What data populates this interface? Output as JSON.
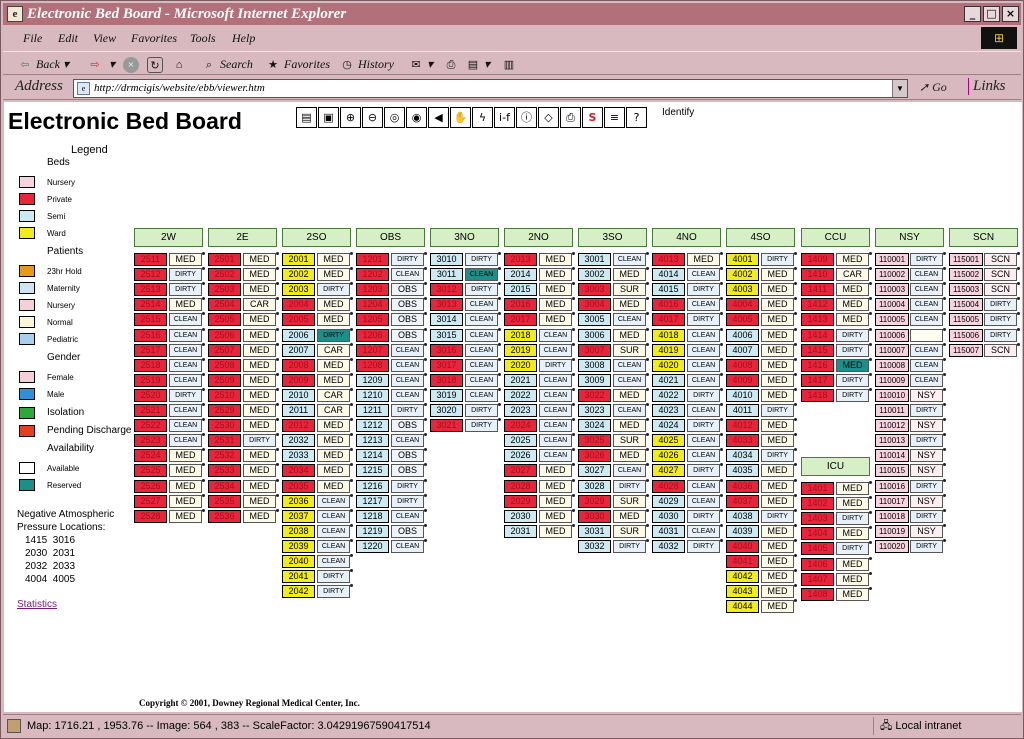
{
  "window": {
    "title": "Electronic Bed Board - Microsoft Internet Explorer"
  },
  "menu": [
    "File",
    "Edit",
    "View",
    "Favorites",
    "Tools",
    "Help"
  ],
  "toolbar": {
    "back": "Back",
    "search": "Search",
    "favorites": "Favorites",
    "history": "History"
  },
  "address": {
    "label": "Address",
    "url": "http://drmcigis/website/ebb/viewer.htm",
    "go": "Go",
    "links": "Links"
  },
  "page": {
    "title": "Electronic Bed Board",
    "identify": "Identify",
    "statistics": "Statistics",
    "copyright": "Copyright © 2001, Downey Regional Medical Center, Inc."
  },
  "maptools": [
    "legend-icon",
    "overview-icon",
    "zoom-in-icon",
    "zoom-out-icon",
    "zoom-extent-icon",
    "zoom-back-icon",
    "back-arrow-icon",
    "pan-icon",
    "lightning-icon",
    "if-icon",
    "info-icon",
    "eraser-icon",
    "print-icon",
    "s-icon",
    "list-icon",
    "help-icon"
  ],
  "colors": {
    "private": "#e8253a",
    "semi": "#cdeaf3",
    "ward": "#f2ec1a",
    "nursery": "#f6d3de",
    "available": "#fdfdf2",
    "reserved": "#1b8f8a",
    "header": "#d6efc6"
  },
  "legend": {
    "title": "Legend",
    "beds_heading": "Beds",
    "beds": [
      {
        "label": "Nursery",
        "color": "#f6d3de"
      },
      {
        "label": "Private",
        "color": "#e8253a"
      },
      {
        "label": "Semi",
        "color": "#cdeaf3"
      },
      {
        "label": "Ward",
        "color": "#f2ec1a"
      }
    ],
    "patients_heading": "Patients",
    "patients": [
      {
        "label": "23hr Hold",
        "color": "#e89a16"
      },
      {
        "label": "Maternity",
        "color": "#cfe3f0"
      },
      {
        "label": "Nursery",
        "color": "#f4cfd8"
      },
      {
        "label": "Normal",
        "color": "#fbf6d6"
      },
      {
        "label": "Pediatric",
        "color": "#a7cff0"
      }
    ],
    "gender_heading": "Gender",
    "gender": [
      {
        "label": "Female",
        "color": "#f4cfd8"
      },
      {
        "label": "Male",
        "color": "#2f8fd8"
      }
    ],
    "isolation": {
      "label": "Isolation",
      "color": "#2fa83a"
    },
    "pending": {
      "label": "Pending Discharge",
      "color": "#e2401e"
    },
    "availability_heading": "Availability",
    "availability": [
      {
        "label": "Available",
        "color": "#ffffff"
      },
      {
        "label": "Reserved",
        "color": "#1b8f8a"
      }
    ]
  },
  "npa": {
    "title1": "Negative Atmospheric",
    "title2": "Pressure Locations:",
    "rows": [
      "1415  3016",
      "2030  2031",
      "2032  2033",
      "4004  4005"
    ]
  },
  "units": [
    {
      "name": "2W",
      "beds": [
        [
          "2511",
          "MED",
          "P"
        ],
        [
          "2512",
          "DIRTY",
          "P"
        ],
        [
          "2513",
          "DIRTY",
          "P"
        ],
        [
          "2514",
          "MED",
          "P"
        ],
        [
          "2515",
          "CLEAN",
          "P"
        ],
        [
          "2516",
          "CLEAN",
          "P"
        ],
        [
          "2517",
          "CLEAN",
          "P"
        ],
        [
          "2518",
          "CLEAN",
          "P"
        ],
        [
          "2519",
          "CLEAN",
          "P"
        ],
        [
          "2520",
          "DIRTY",
          "P"
        ],
        [
          "2521",
          "CLEAN",
          "P"
        ],
        [
          "2522",
          "CLEAN",
          "P"
        ],
        [
          "2523",
          "CLEAN",
          "P"
        ],
        [
          "2524",
          "MED",
          "P"
        ],
        [
          "2525",
          "MED",
          "P"
        ],
        [
          "2526",
          "MED",
          "P"
        ],
        [
          "2527",
          "MED",
          "P"
        ],
        [
          "2528",
          "MED",
          "P"
        ]
      ]
    },
    {
      "name": "2E",
      "beds": [
        [
          "2501",
          "MED",
          "P"
        ],
        [
          "2502",
          "MED",
          "P"
        ],
        [
          "2503",
          "MED",
          "P"
        ],
        [
          "2504",
          "CAR",
          "P"
        ],
        [
          "2505",
          "MED",
          "P"
        ],
        [
          "2506",
          "MED",
          "P"
        ],
        [
          "2507",
          "MED",
          "P"
        ],
        [
          "2508",
          "MED",
          "P"
        ],
        [
          "2509",
          "MED",
          "P"
        ],
        [
          "2510",
          "MED",
          "P"
        ],
        [
          "2529",
          "MED",
          "P"
        ],
        [
          "2530",
          "MED",
          "P"
        ],
        [
          "2531",
          "DIRTY",
          "P"
        ],
        [
          "2532",
          "MED",
          "P"
        ],
        [
          "2533",
          "MED",
          "P"
        ],
        [
          "2534",
          "MED",
          "P"
        ],
        [
          "2535",
          "MED",
          "P"
        ],
        [
          "2536",
          "MED",
          "P"
        ]
      ]
    },
    {
      "name": "2SO",
      "beds": [
        [
          "2001",
          "MED",
          "W"
        ],
        [
          "2002",
          "MED",
          "W"
        ],
        [
          "2003",
          "DIRTY",
          "W"
        ],
        [
          "2004",
          "MED",
          "P"
        ],
        [
          "2005",
          "MED",
          "P"
        ],
        [
          "2006",
          "DIRTY",
          "S",
          "R"
        ],
        [
          "2007",
          "CAR",
          "S"
        ],
        [
          "2008",
          "MED",
          "P"
        ],
        [
          "2009",
          "MED",
          "P"
        ],
        [
          "2010",
          "CAR",
          "S"
        ],
        [
          "2011",
          "CAR",
          "S"
        ],
        [
          "2012",
          "MED",
          "P"
        ],
        [
          "2032",
          "MED",
          "S"
        ],
        [
          "2033",
          "MED",
          "S"
        ],
        [
          "2034",
          "MED",
          "P"
        ],
        [
          "2035",
          "MED",
          "P"
        ],
        [
          "2036",
          "CLEAN",
          "W"
        ],
        [
          "2037",
          "CLEAN",
          "W"
        ],
        [
          "2038",
          "CLEAN",
          "W"
        ],
        [
          "2039",
          "CLEAN",
          "W"
        ],
        [
          "2040",
          "CLEAN",
          "W"
        ],
        [
          "2041",
          "DIRTY",
          "W"
        ],
        [
          "2042",
          "DIRTY",
          "W"
        ]
      ]
    },
    {
      "name": "OBS",
      "beds": [
        [
          "1201",
          "DIRTY",
          "P"
        ],
        [
          "1202",
          "CLEAN",
          "P"
        ],
        [
          "1203",
          "OBS",
          "P"
        ],
        [
          "1204",
          "OBS",
          "P"
        ],
        [
          "1205",
          "OBS",
          "P"
        ],
        [
          "1206",
          "OBS",
          "P"
        ],
        [
          "1207",
          "CLEAN",
          "P"
        ],
        [
          "1208",
          "CLEAN",
          "P"
        ],
        [
          "1209",
          "CLEAN",
          "S"
        ],
        [
          "1210",
          "CLEAN",
          "S"
        ],
        [
          "1211",
          "DIRTY",
          "S"
        ],
        [
          "1212",
          "OBS",
          "S"
        ],
        [
          "1213",
          "CLEAN",
          "S"
        ],
        [
          "1214",
          "OBS",
          "S"
        ],
        [
          "1215",
          "OBS",
          "S"
        ],
        [
          "1216",
          "DIRTY",
          "S"
        ],
        [
          "1217",
          "DIRTY",
          "S"
        ],
        [
          "1218",
          "CLEAN",
          "S"
        ],
        [
          "1219",
          "OBS",
          "S"
        ],
        [
          "1220",
          "CLEAN",
          "S"
        ]
      ]
    },
    {
      "name": "3NO",
      "beds": [
        [
          "3010",
          "DIRTY",
          "S"
        ],
        [
          "3011",
          "CLEAN",
          "S",
          "R"
        ],
        [
          "3012",
          "DIRTY",
          "P"
        ],
        [
          "3013",
          "CLEAN",
          "P"
        ],
        [
          "3014",
          "CLEAN",
          "S"
        ],
        [
          "3015",
          "CLEAN",
          "S"
        ],
        [
          "3016",
          "CLEAN",
          "P"
        ],
        [
          "3017",
          "CLEAN",
          "P"
        ],
        [
          "3018",
          "CLEAN",
          "P"
        ],
        [
          "3019",
          "CLEAN",
          "S"
        ],
        [
          "3020",
          "DIRTY",
          "S"
        ],
        [
          "3021",
          "DIRTY",
          "P"
        ]
      ]
    },
    {
      "name": "2NO",
      "beds": [
        [
          "2013",
          "MED",
          "P"
        ],
        [
          "2014",
          "MED",
          "S"
        ],
        [
          "2015",
          "MED",
          "S"
        ],
        [
          "2016",
          "MED",
          "P"
        ],
        [
          "2017",
          "MED",
          "P"
        ],
        [
          "2018",
          "CLEAN",
          "W"
        ],
        [
          "2019",
          "CLEAN",
          "W"
        ],
        [
          "2020",
          "DIRTY",
          "W"
        ],
        [
          "2021",
          "CLEAN",
          "S"
        ],
        [
          "2022",
          "CLEAN",
          "S"
        ],
        [
          "2023",
          "CLEAN",
          "S"
        ],
        [
          "2024",
          "CLEAN",
          "P"
        ],
        [
          "2025",
          "CLEAN",
          "S"
        ],
        [
          "2026",
          "CLEAN",
          "S"
        ],
        [
          "2027",
          "MED",
          "P"
        ],
        [
          "2028",
          "MED",
          "P"
        ],
        [
          "2029",
          "MED",
          "P"
        ],
        [
          "2030",
          "MED",
          "S"
        ],
        [
          "2031",
          "MED",
          "S"
        ]
      ]
    },
    {
      "name": "3SO",
      "beds": [
        [
          "3001",
          "CLEAN",
          "S"
        ],
        [
          "3002",
          "MED",
          "S"
        ],
        [
          "3003",
          "SUR",
          "P"
        ],
        [
          "3004",
          "MED",
          "P"
        ],
        [
          "3005",
          "CLEAN",
          "S"
        ],
        [
          "3006",
          "MED",
          "S"
        ],
        [
          "3007",
          "SUR",
          "P"
        ],
        [
          "3008",
          "CLEAN",
          "S"
        ],
        [
          "3009",
          "CLEAN",
          "S"
        ],
        [
          "3022",
          "MED",
          "P"
        ],
        [
          "3023",
          "CLEAN",
          "S"
        ],
        [
          "3024",
          "MED",
          "S"
        ],
        [
          "3025",
          "SUR",
          "P"
        ],
        [
          "3026",
          "MED",
          "P"
        ],
        [
          "3027",
          "CLEAN",
          "S"
        ],
        [
          "3028",
          "DIRTY",
          "S"
        ],
        [
          "3029",
          "SUR",
          "P"
        ],
        [
          "3030",
          "MED",
          "P"
        ],
        [
          "3031",
          "SUR",
          "S"
        ],
        [
          "3032",
          "DIRTY",
          "S"
        ]
      ]
    },
    {
      "name": "4NO",
      "beds": [
        [
          "4013",
          "MED",
          "P"
        ],
        [
          "4014",
          "CLEAN",
          "S"
        ],
        [
          "4015",
          "DIRTY",
          "S"
        ],
        [
          "4016",
          "CLEAN",
          "P"
        ],
        [
          "4017",
          "DIRTY",
          "P"
        ],
        [
          "4018",
          "CLEAN",
          "W"
        ],
        [
          "4019",
          "CLEAN",
          "W"
        ],
        [
          "4020",
          "CLEAN",
          "W"
        ],
        [
          "4021",
          "CLEAN",
          "S"
        ],
        [
          "4022",
          "DIRTY",
          "S"
        ],
        [
          "4023",
          "CLEAN",
          "S"
        ],
        [
          "4024",
          "DIRTY",
          "S"
        ],
        [
          "4025",
          "CLEAN",
          "W"
        ],
        [
          "4026",
          "CLEAN",
          "W"
        ],
        [
          "4027",
          "DIRTY",
          "W"
        ],
        [
          "4028",
          "CLEAN",
          "P"
        ],
        [
          "4029",
          "CLEAN",
          "S"
        ],
        [
          "4030",
          "DIRTY",
          "S"
        ],
        [
          "4031",
          "CLEAN",
          "S"
        ],
        [
          "4032",
          "DIRTY",
          "S"
        ]
      ]
    },
    {
      "name": "4SO",
      "beds": [
        [
          "4001",
          "DIRTY",
          "W"
        ],
        [
          "4002",
          "MED",
          "W"
        ],
        [
          "4003",
          "MED",
          "W"
        ],
        [
          "4004",
          "MED",
          "P"
        ],
        [
          "4005",
          "MED",
          "P"
        ],
        [
          "4006",
          "MED",
          "S"
        ],
        [
          "4007",
          "MED",
          "S"
        ],
        [
          "4008",
          "MED",
          "P"
        ],
        [
          "4009",
          "MED",
          "P"
        ],
        [
          "4010",
          "MED",
          "S"
        ],
        [
          "4011",
          "DIRTY",
          "S"
        ],
        [
          "4012",
          "MED",
          "P"
        ],
        [
          "4033",
          "MED",
          "P"
        ],
        [
          "4034",
          "DIRTY",
          "S"
        ],
        [
          "4035",
          "MED",
          "S"
        ],
        [
          "4036",
          "MED",
          "P"
        ],
        [
          "4037",
          "MED",
          "P"
        ],
        [
          "4038",
          "DIRTY",
          "S"
        ],
        [
          "4039",
          "MED",
          "S"
        ],
        [
          "4040",
          "MED",
          "P"
        ],
        [
          "4041",
          "MED",
          "P"
        ],
        [
          "4042",
          "MED",
          "W"
        ],
        [
          "4043",
          "MED",
          "W"
        ],
        [
          "4044",
          "MED",
          "W"
        ]
      ]
    },
    {
      "name": "CCU",
      "beds": [
        [
          "1409",
          "MED",
          "P"
        ],
        [
          "1410",
          "CAR",
          "P"
        ],
        [
          "1411",
          "MED",
          "P"
        ],
        [
          "1412",
          "MED",
          "P"
        ],
        [
          "1413",
          "MED",
          "P"
        ],
        [
          "1414",
          "DIRTY",
          "P"
        ],
        [
          "1415",
          "DIRTY",
          "P"
        ],
        [
          "1416",
          "MED",
          "P",
          "R"
        ],
        [
          "1417",
          "DIRTY",
          "P"
        ],
        [
          "1418",
          "DIRTY",
          "P"
        ]
      ]
    },
    {
      "name": "ICU",
      "beds": [
        [
          "1401",
          "MED",
          "P"
        ],
        [
          "1402",
          "MED",
          "P"
        ],
        [
          "1403",
          "DIRTY",
          "P"
        ],
        [
          "1404",
          "MED",
          "P"
        ],
        [
          "1405",
          "DIRTY",
          "P"
        ],
        [
          "1406",
          "MED",
          "P"
        ],
        [
          "1407",
          "MED",
          "P"
        ],
        [
          "1408",
          "MED",
          "P"
        ]
      ]
    },
    {
      "name": "NSY",
      "beds": [
        [
          "110001",
          "DIRTY",
          "N"
        ],
        [
          "110002",
          "CLEAN",
          "N"
        ],
        [
          "110003",
          "CLEAN",
          "N"
        ],
        [
          "110004",
          "CLEAN",
          "N"
        ],
        [
          "110005",
          "CLEAN",
          "N"
        ],
        [
          "110006",
          "",
          "N"
        ],
        [
          "110007",
          "CLEAN",
          "N"
        ],
        [
          "110008",
          "CLEAN",
          "N"
        ],
        [
          "110009",
          "CLEAN",
          "N"
        ],
        [
          "110010",
          "NSY",
          "N"
        ],
        [
          "110011",
          "DIRTY",
          "N"
        ],
        [
          "110012",
          "NSY",
          "N"
        ],
        [
          "110013",
          "DIRTY",
          "N"
        ],
        [
          "110014",
          "NSY",
          "N"
        ],
        [
          "110015",
          "NSY",
          "N"
        ],
        [
          "110016",
          "DIRTY",
          "N"
        ],
        [
          "110017",
          "NSY",
          "N"
        ],
        [
          "110018",
          "DIRTY",
          "N"
        ],
        [
          "110019",
          "NSY",
          "N"
        ],
        [
          "110020",
          "DIRTY",
          "N"
        ]
      ]
    },
    {
      "name": "SCN",
      "beds": [
        [
          "115001",
          "SCN",
          "N"
        ],
        [
          "115002",
          "SCN",
          "N"
        ],
        [
          "115003",
          "SCN",
          "N"
        ],
        [
          "115004",
          "DIRTY",
          "N"
        ],
        [
          "115005",
          "DIRTY",
          "N"
        ],
        [
          "115006",
          "DIRTY",
          "N"
        ],
        [
          "115007",
          "SCN",
          "N"
        ]
      ]
    }
  ],
  "status": {
    "text": "Map: 1716.21 , 1953.76 -- Image: 564 , 383 -- ScaleFactor: 3.04291967590417514",
    "zone": "Local intranet"
  }
}
